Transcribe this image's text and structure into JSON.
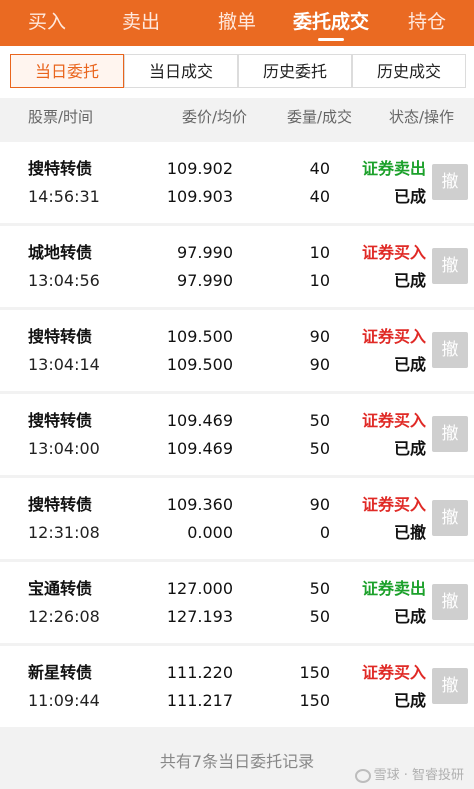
{
  "top_tabs": [
    {
      "label": "买入",
      "active": false
    },
    {
      "label": "卖出",
      "active": false
    },
    {
      "label": "撤单",
      "active": false
    },
    {
      "label": "委托成交",
      "active": true
    },
    {
      "label": "持仓",
      "active": false
    }
  ],
  "sub_tabs": [
    {
      "label": "当日委托",
      "active": true
    },
    {
      "label": "当日成交",
      "active": false
    },
    {
      "label": "历史委托",
      "active": false
    },
    {
      "label": "历史成交",
      "active": false
    }
  ],
  "columns": {
    "stock_time": "股票/时间",
    "price": "委价/均价",
    "qty": "委量/成交",
    "status": "状态/操作"
  },
  "orders": [
    {
      "name": "搜特转债",
      "time": "14:56:31",
      "order_price": "109.902",
      "avg_price": "109.903",
      "order_qty": "40",
      "filled_qty": "40",
      "side": "证券卖出",
      "side_type": "sell",
      "status": "已成",
      "action": "撤"
    },
    {
      "name": "城地转债",
      "time": "13:04:56",
      "order_price": "97.990",
      "avg_price": "97.990",
      "order_qty": "10",
      "filled_qty": "10",
      "side": "证券买入",
      "side_type": "buy",
      "status": "已成",
      "action": "撤"
    },
    {
      "name": "搜特转债",
      "time": "13:04:14",
      "order_price": "109.500",
      "avg_price": "109.500",
      "order_qty": "90",
      "filled_qty": "90",
      "side": "证券买入",
      "side_type": "buy",
      "status": "已成",
      "action": "撤"
    },
    {
      "name": "搜特转债",
      "time": "13:04:00",
      "order_price": "109.469",
      "avg_price": "109.469",
      "order_qty": "50",
      "filled_qty": "50",
      "side": "证券买入",
      "side_type": "buy",
      "status": "已成",
      "action": "撤"
    },
    {
      "name": "搜特转债",
      "time": "12:31:08",
      "order_price": "109.360",
      "avg_price": "0.000",
      "order_qty": "90",
      "filled_qty": "0",
      "side": "证券买入",
      "side_type": "buy",
      "status": "已撤",
      "action": "撤"
    },
    {
      "name": "宝通转债",
      "time": "12:26:08",
      "order_price": "127.000",
      "avg_price": "127.193",
      "order_qty": "50",
      "filled_qty": "50",
      "side": "证券卖出",
      "side_type": "sell",
      "status": "已成",
      "action": "撤"
    },
    {
      "name": "新星转债",
      "time": "11:09:44",
      "order_price": "111.220",
      "avg_price": "111.217",
      "order_qty": "150",
      "filled_qty": "150",
      "side": "证券买入",
      "side_type": "buy",
      "status": "已成",
      "action": "撤"
    }
  ],
  "footer": {
    "count_text": "共有7条当日委托记录"
  },
  "watermark": {
    "text": "雪球 · 智睿投研"
  },
  "colors": {
    "brand": "#ea6a22",
    "buy": "#e02a26",
    "sell": "#1ca12b"
  }
}
